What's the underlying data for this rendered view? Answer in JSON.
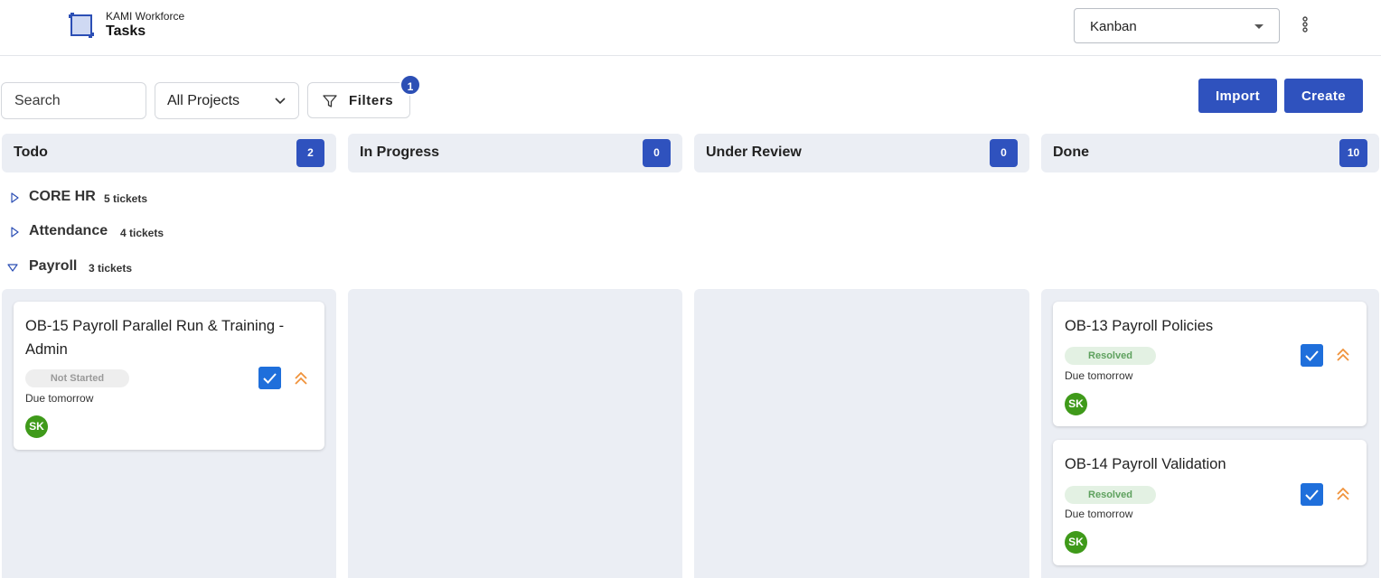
{
  "header": {
    "brand_sub": "KAMI Workforce",
    "brand_title": "Tasks",
    "view_select": "Kanban"
  },
  "toolbar": {
    "search_placeholder": "Search",
    "projects": "All Projects",
    "filters_label": "Filters",
    "filters_count": "1",
    "import_label": "Import",
    "create_label": "Create"
  },
  "columns": [
    {
      "name": "Todo",
      "count": "2"
    },
    {
      "name": "In Progress",
      "count": "0"
    },
    {
      "name": "Under Review",
      "count": "0"
    },
    {
      "name": "Done",
      "count": "10"
    }
  ],
  "groups": [
    {
      "name": "CORE HR",
      "count": "5 tickets",
      "expanded": false
    },
    {
      "name": "Attendance",
      "count": "4 tickets",
      "expanded": false
    },
    {
      "name": "Payroll",
      "count": "3 tickets",
      "expanded": true
    }
  ],
  "cards": {
    "todo": [
      {
        "title": "OB-15 Payroll Parallel Run & Training - Admin",
        "status": "Not Started",
        "due": "Due tomorrow",
        "assignee": "SK"
      }
    ],
    "done": [
      {
        "title": "OB-13 Payroll Policies",
        "status": "Resolved",
        "due": "Due tomorrow",
        "assignee": "SK"
      },
      {
        "title": "OB-14 Payroll Validation",
        "status": "Resolved",
        "due": "Due tomorrow",
        "assignee": "SK"
      }
    ]
  },
  "colors": {
    "primary": "#2f52be",
    "checkbox": "#1f6fdb",
    "priority": "#f0923b",
    "avatar": "#3f9a1a",
    "lane": "#ebeef4"
  },
  "icons": {
    "logo": "crop-logo-icon",
    "menu": "kebab-menu-icon",
    "filter": "funnel-icon",
    "priority": "double-chevron-up-icon",
    "collapsed": "triangle-right-icon",
    "expanded": "triangle-down-icon"
  }
}
